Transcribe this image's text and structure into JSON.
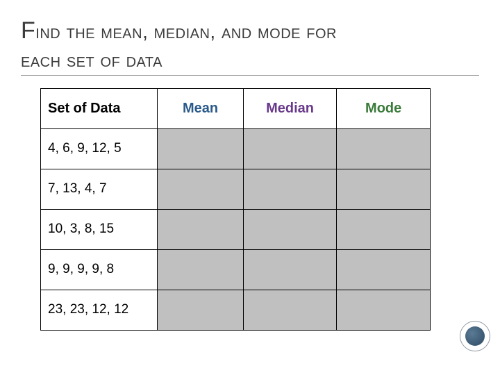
{
  "title": {
    "line1_first": "F",
    "line1_rest": "ind the mean, median, and mode for",
    "line2": "each set of data"
  },
  "headers": {
    "set": "Set of Data",
    "mean": "Mean",
    "median": "Median",
    "mode": "Mode"
  },
  "rows": [
    {
      "label": "4, 6, 9, 12, 5",
      "mean": "",
      "median": "",
      "mode": ""
    },
    {
      "label": "7, 13, 4, 7",
      "mean": "",
      "median": "",
      "mode": ""
    },
    {
      "label": "10, 3, 8, 15",
      "mean": "",
      "median": "",
      "mode": ""
    },
    {
      "label": "9, 9, 9, 9, 8",
      "mean": "",
      "median": "",
      "mode": ""
    },
    {
      "label": "23, 23, 12, 12",
      "mean": "",
      "median": "",
      "mode": ""
    }
  ]
}
